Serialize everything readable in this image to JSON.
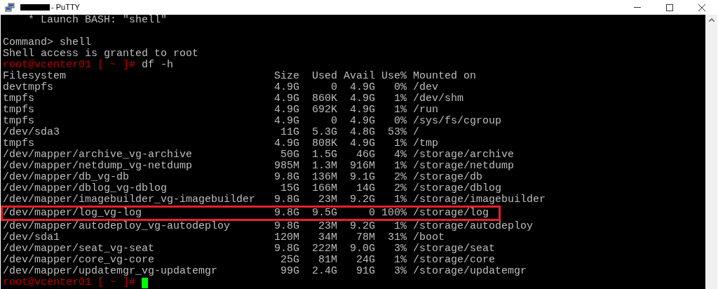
{
  "window": {
    "title": "- PuTTY",
    "title_redacted": true
  },
  "terminal": {
    "lines": [
      {
        "kind": "text",
        "text": "    * Launch BASH: \"shell\""
      },
      {
        "kind": "blank"
      },
      {
        "kind": "text",
        "text": "Command> shell"
      },
      {
        "kind": "text",
        "text": "Shell access is granted to root"
      },
      {
        "kind": "prompt",
        "prompt": "root@vcenter01 [ ~ ]#",
        "command": "df -h"
      }
    ],
    "df": {
      "header": [
        "Filesystem",
        "Size",
        "Used",
        "Avail",
        "Use%",
        "Mounted on"
      ],
      "rows": [
        {
          "cells": [
            "devtmpfs",
            "4.9G",
            "0",
            "4.9G",
            "0%",
            "/dev"
          ],
          "highlighted": false
        },
        {
          "cells": [
            "tmpfs",
            "4.9G",
            "860K",
            "4.9G",
            "1%",
            "/dev/shm"
          ],
          "highlighted": false
        },
        {
          "cells": [
            "tmpfs",
            "4.9G",
            "692K",
            "4.9G",
            "1%",
            "/run"
          ],
          "highlighted": false
        },
        {
          "cells": [
            "tmpfs",
            "4.9G",
            "0",
            "4.9G",
            "0%",
            "/sys/fs/cgroup"
          ],
          "highlighted": false
        },
        {
          "cells": [
            "/dev/sda3",
            "11G",
            "5.3G",
            "4.8G",
            "53%",
            "/"
          ],
          "highlighted": false
        },
        {
          "cells": [
            "tmpfs",
            "4.9G",
            "808K",
            "4.9G",
            "1%",
            "/tmp"
          ],
          "highlighted": false
        },
        {
          "cells": [
            "/dev/mapper/archive_vg-archive",
            "50G",
            "1.5G",
            "46G",
            "4%",
            "/storage/archive"
          ],
          "highlighted": false
        },
        {
          "cells": [
            "/dev/mapper/netdump_vg-netdump",
            "985M",
            "1.3M",
            "916M",
            "1%",
            "/storage/netdump"
          ],
          "highlighted": false
        },
        {
          "cells": [
            "/dev/mapper/db_vg-db",
            "9.8G",
            "136M",
            "9.1G",
            "2%",
            "/storage/db"
          ],
          "highlighted": false
        },
        {
          "cells": [
            "/dev/mapper/dblog_vg-dblog",
            "15G",
            "166M",
            "14G",
            "2%",
            "/storage/dblog"
          ],
          "highlighted": false
        },
        {
          "cells": [
            "/dev/mapper/imagebuilder_vg-imagebuilder",
            "9.8G",
            "23M",
            "9.2G",
            "1%",
            "/storage/imagebuilder"
          ],
          "highlighted": false
        },
        {
          "cells": [
            "/dev/mapper/log_vg-log",
            "9.8G",
            "9.5G",
            "0",
            "100%",
            "/storage/log"
          ],
          "highlighted": true
        },
        {
          "cells": [
            "/dev/mapper/autodeploy_vg-autodeploy",
            "9.8G",
            "23M",
            "9.2G",
            "1%",
            "/storage/autodeploy"
          ],
          "highlighted": false
        },
        {
          "cells": [
            "/dev/sda1",
            "120M",
            "34M",
            "78M",
            "31%",
            "/boot"
          ],
          "highlighted": false
        },
        {
          "cells": [
            "/dev/mapper/seat_vg-seat",
            "9.8G",
            "222M",
            "9.0G",
            "3%",
            "/storage/seat"
          ],
          "highlighted": false
        },
        {
          "cells": [
            "/dev/mapper/core_vg-core",
            "25G",
            "81M",
            "24G",
            "1%",
            "/storage/core"
          ],
          "highlighted": false
        },
        {
          "cells": [
            "/dev/mapper/updatemgr_vg-updatemgr",
            "99G",
            "2.4G",
            "91G",
            "3%",
            "/storage/updatemgr"
          ],
          "highlighted": false
        }
      ]
    },
    "end_prompt": {
      "prompt": "root@vcenter01 [ ~ ]#",
      "cursor": true
    }
  }
}
